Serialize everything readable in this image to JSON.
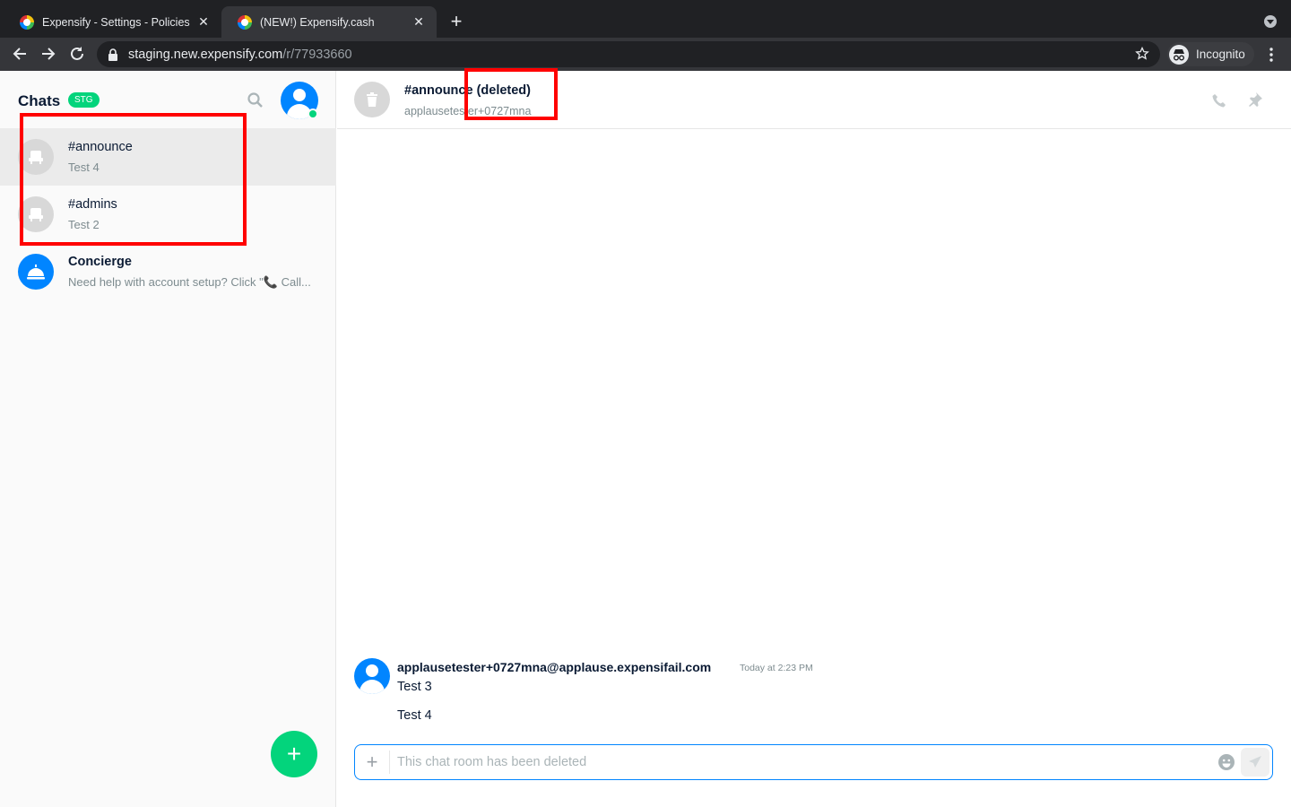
{
  "browser": {
    "tabs": [
      {
        "title": "Expensify - Settings - Policies",
        "active": false
      },
      {
        "title": "(NEW!) Expensify.cash",
        "active": true
      }
    ],
    "url_host": "staging.new.expensify.com",
    "url_path": "/r/77933660",
    "incognito_label": "Incognito"
  },
  "sidebar": {
    "title": "Chats",
    "badge": "STG",
    "chats": [
      {
        "name": "#announce",
        "preview": "Test 4",
        "selected": true,
        "avatar": "room-icon"
      },
      {
        "name": "#admins",
        "preview": "Test 2",
        "selected": false,
        "avatar": "room-icon"
      },
      {
        "name": "Concierge",
        "preview": "Need help with account setup? Click \"📞 Call...",
        "selected": false,
        "avatar": "concierge-bell-icon"
      }
    ],
    "fab_label": "+"
  },
  "header": {
    "title": "#announce (deleted)",
    "subtitle": "applausetester+0727mna"
  },
  "message": {
    "author": "applausetester+0727mna@applause.expensifail.com",
    "time": "Today at 2:23 PM",
    "lines": [
      "Test 3",
      "Test 4"
    ]
  },
  "composer": {
    "placeholder": "This chat room has been deleted"
  },
  "colors": {
    "accent_green": "#03d47c",
    "accent_blue": "#0185ff",
    "annotation_red": "#ff0000"
  }
}
